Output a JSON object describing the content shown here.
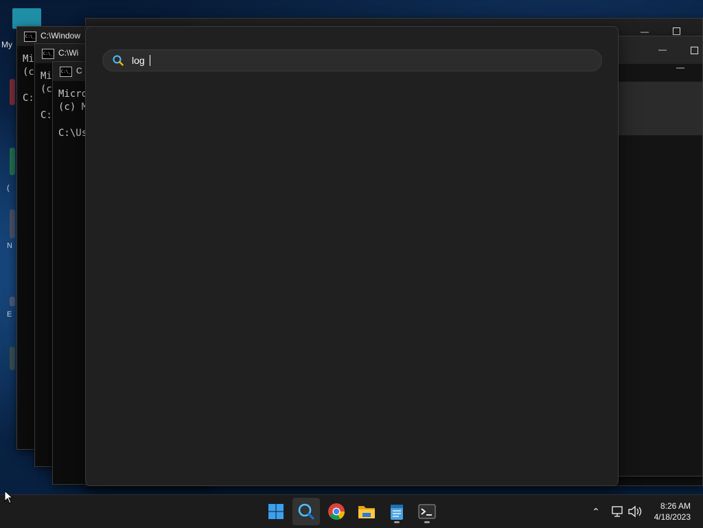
{
  "desktop": {
    "icon_label": "My",
    "fragments": [
      "N",
      "E",
      "("
    ]
  },
  "windows": [
    {
      "title": "C:\\Window",
      "lines": [
        "Mi",
        "(c",
        "",
        "C:"
      ]
    },
    {
      "title": "C:\\Wi",
      "lines": [
        "Mi",
        "(c",
        "",
        "C:"
      ]
    },
    {
      "title": "C",
      "lines": [
        "Micro",
        "(c) M",
        "",
        "C:\\Us"
      ]
    }
  ],
  "search": {
    "query": "log"
  },
  "taskbar": {
    "apps": [
      "start-icon",
      "search-icon",
      "chrome-icon",
      "file-explorer-icon",
      "notepad-icon",
      "terminal-icon"
    ],
    "clock": {
      "time": "8:26 AM",
      "date": "4/18/2023"
    }
  }
}
